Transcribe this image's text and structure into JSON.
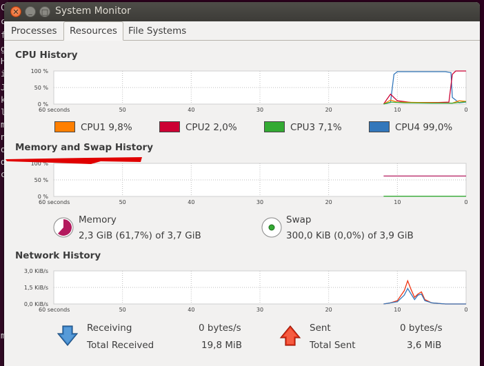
{
  "window": {
    "title": "System Monitor"
  },
  "tabs": [
    {
      "label": "Processes"
    },
    {
      "label": "Resources"
    },
    {
      "label": "File Systems"
    }
  ],
  "background_terminal": {
    "chars": [
      "C",
      "c",
      "f",
      "g",
      "H",
      "i",
      "J",
      "k",
      "l",
      "m",
      "n",
      "o",
      "d",
      "c",
      "m"
    ]
  },
  "cpu": {
    "title": "CPU History",
    "y_ticks": [
      "100 %",
      "50 %",
      "0 %"
    ],
    "x_ticks": [
      "60 seconds",
      "50",
      "40",
      "30",
      "20",
      "10",
      "0"
    ],
    "legend": [
      {
        "label": "CPU1",
        "value": "9,8%",
        "color": "#ff7f00"
      },
      {
        "label": "CPU2",
        "value": "2,0%",
        "color": "#cc0033"
      },
      {
        "label": "CPU3",
        "value": "7,1%",
        "color": "#33aa33"
      },
      {
        "label": "CPU4",
        "value": "99,0%",
        "color": "#3377bb"
      }
    ]
  },
  "memory": {
    "title": "Memory and Swap History",
    "y_ticks": [
      "100 %",
      "50 %",
      "0 %"
    ],
    "x_ticks": [
      "60 seconds",
      "50",
      "40",
      "30",
      "20",
      "10",
      "0"
    ],
    "memory_label": "Memory",
    "memory_value": "2,3 GiB (61,7%) of 3,7 GiB",
    "memory_fraction": 0.617,
    "memory_color": "#b31a5e",
    "swap_label": "Swap",
    "swap_value": "300,0 KiB (0,0%) of 3,9 GiB",
    "swap_fraction": 0.0,
    "swap_color": "#33aa33"
  },
  "network": {
    "title": "Network History",
    "y_ticks": [
      "3,0 KiB/s",
      "1,5 KiB/s",
      "0,0 KiB/s"
    ],
    "x_ticks": [
      "60 seconds",
      "50",
      "40",
      "30",
      "20",
      "10",
      "0"
    ],
    "receiving_label": "Receiving",
    "receiving_value": "0 bytes/s",
    "total_received_label": "Total Received",
    "total_received_value": "19,8 MiB",
    "sent_label": "Sent",
    "sent_value": "0 bytes/s",
    "total_sent_label": "Total Sent",
    "total_sent_value": "3,6 MiB",
    "receiving_color": "#3377bb",
    "sent_color": "#ee3311"
  }
}
